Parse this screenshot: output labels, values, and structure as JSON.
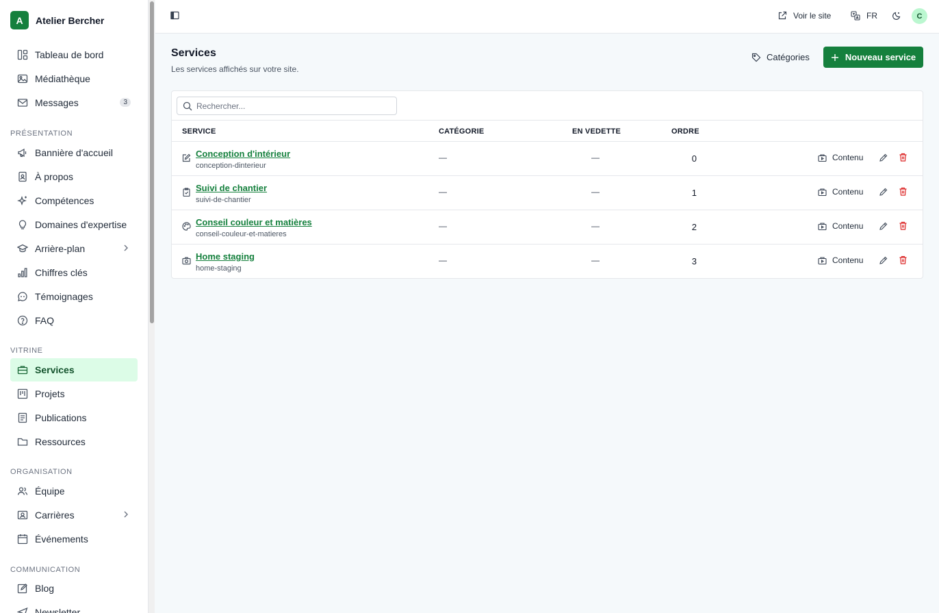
{
  "brand": {
    "letter": "A",
    "name": "Atelier Bercher"
  },
  "sidebar": {
    "top_items": [
      {
        "label": "Tableau de bord"
      },
      {
        "label": "Médiathèque"
      },
      {
        "label": "Messages",
        "badge": "3"
      }
    ],
    "sections": [
      {
        "label": "PRÉSENTATION",
        "items": [
          {
            "label": "Bannière d'accueil"
          },
          {
            "label": "À propos"
          },
          {
            "label": "Compétences"
          },
          {
            "label": "Domaines d'expertise"
          },
          {
            "label": "Arrière-plan"
          },
          {
            "label": "Chiffres clés"
          },
          {
            "label": "Témoignages"
          },
          {
            "label": "FAQ"
          }
        ]
      },
      {
        "label": "VITRINE",
        "items": [
          {
            "label": "Services"
          },
          {
            "label": "Projets"
          },
          {
            "label": "Publications"
          },
          {
            "label": "Ressources"
          }
        ]
      },
      {
        "label": "ORGANISATION",
        "items": [
          {
            "label": "Équipe"
          },
          {
            "label": "Carrières"
          },
          {
            "label": "Événements"
          }
        ]
      },
      {
        "label": "COMMUNICATION",
        "items": [
          {
            "label": "Blog"
          },
          {
            "label": "Newsletter"
          }
        ]
      }
    ]
  },
  "topbar": {
    "view_site": "Voir le site",
    "language": "FR",
    "avatar": "C"
  },
  "page": {
    "title": "Services",
    "subtitle": "Les services affichés sur votre site.",
    "categories_button": "Catégories",
    "new_button": "Nouveau service"
  },
  "search": {
    "placeholder": "Rechercher..."
  },
  "table": {
    "headers": {
      "service": "SERVICE",
      "category": "CATÉGORIE",
      "featured": "EN VEDETTE",
      "order": "ORDRE"
    },
    "content_label": "Contenu",
    "rows": [
      {
        "title": "Conception d'intérieur",
        "slug": "conception-dinterieur",
        "category": "—",
        "featured": "—",
        "order": "0",
        "icon": "pencil-square-icon"
      },
      {
        "title": "Suivi de chantier",
        "slug": "suivi-de-chantier",
        "category": "—",
        "featured": "—",
        "order": "1",
        "icon": "clipboard-check-icon"
      },
      {
        "title": "Conseil couleur et matières",
        "slug": "conseil-couleur-et-matieres",
        "category": "—",
        "featured": "—",
        "order": "2",
        "icon": "palette-icon"
      },
      {
        "title": "Home staging",
        "slug": "home-staging",
        "category": "—",
        "featured": "—",
        "order": "3",
        "icon": "camera-icon"
      }
    ]
  },
  "colors": {
    "accent": "#15803d",
    "active_bg": "#dcfce7",
    "danger": "#dc2626"
  }
}
